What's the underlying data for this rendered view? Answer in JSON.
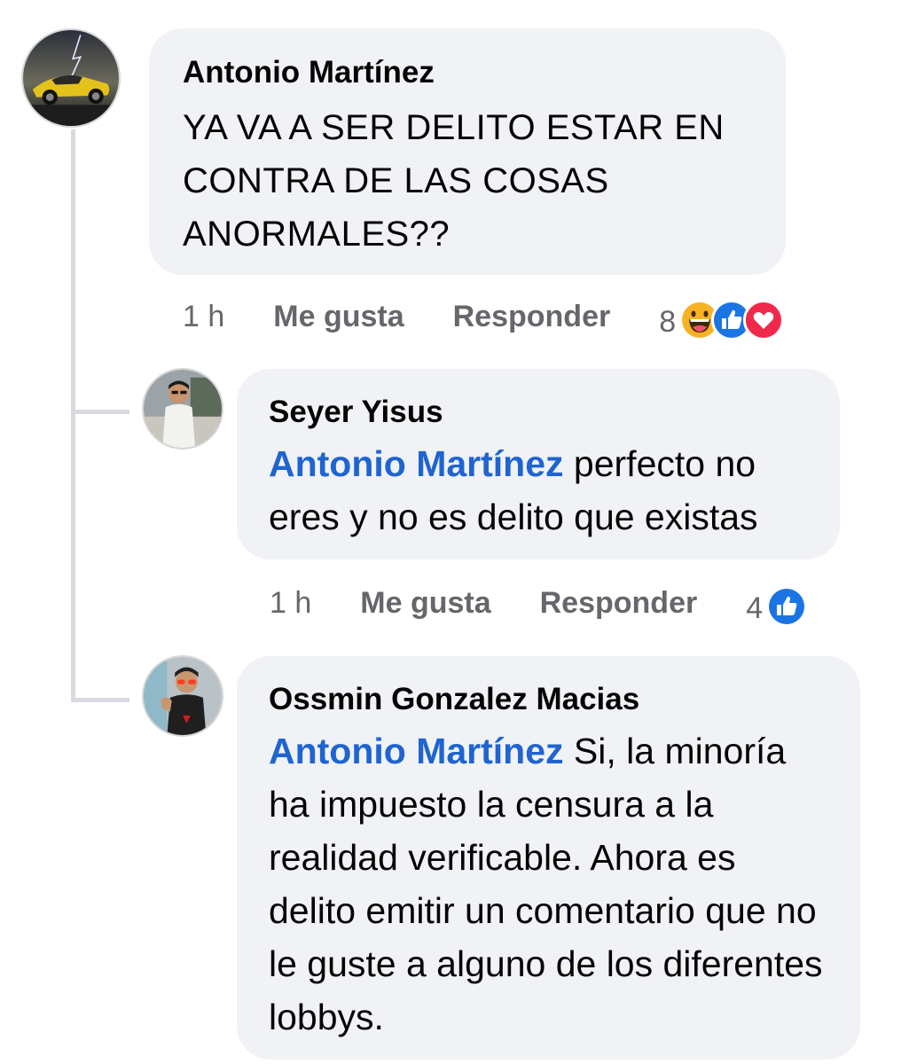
{
  "comments": [
    {
      "author": "Antonio Martínez",
      "text": "YA VA A SER DELITO ESTAR EN CONTRA DE LAS COSAS ANORMALES??",
      "time": "1 h",
      "like_label": "Me gusta",
      "reply_label": "Responder",
      "reaction_count": "8",
      "reactions": [
        "haha-icon",
        "like-icon",
        "love-icon"
      ]
    },
    {
      "author": "Seyer Yisus",
      "mention": "Antonio Martínez",
      "text": " perfecto no eres y no es delito que existas",
      "time": "1 h",
      "like_label": "Me gusta",
      "reply_label": "Responder",
      "reaction_count": "4",
      "reactions": [
        "like-icon"
      ]
    },
    {
      "author": "Ossmin Gonzalez Macias",
      "mention": "Antonio Martínez",
      "text": " Si, la minoría ha impuesto la censura a la realidad verificable. Ahora es delito emitir un comentario que no le guste a alguno de los diferentes lobbys."
    }
  ],
  "colors": {
    "bubble": "#f0f2f5",
    "mention": "#1f64d1",
    "meta": "#65676b",
    "like": "#1b74e4",
    "love": "#f02849",
    "haha": "#f7b125"
  }
}
